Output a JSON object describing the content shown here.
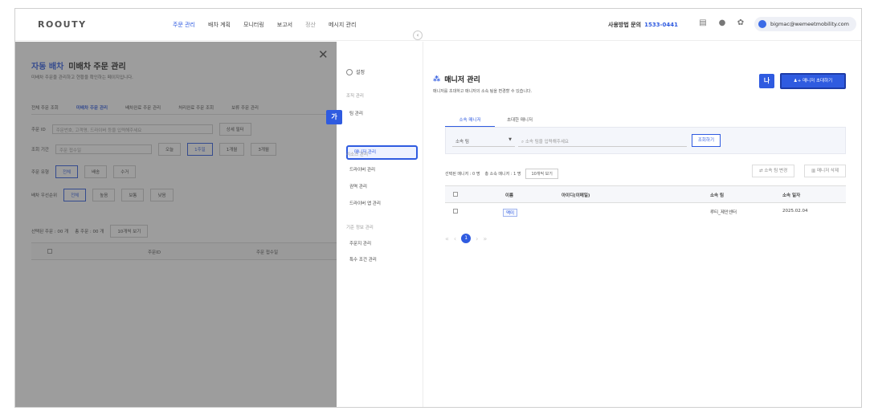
{
  "topbar": {
    "logo": "ROOUTY",
    "nav": [
      "주문 관리",
      "배차 계획",
      "모니터링",
      "보고서",
      "정산",
      "메시지 관리"
    ],
    "contact_label": "사용방법 문의",
    "contact_number": "1533-0441",
    "user_email": "bigmac@wemeetmobility.com"
  },
  "left_page": {
    "crumb": "자동 배차",
    "title": "미배차 주문 관리",
    "desc": "미배차 주문을 관리하고 현황을 확인하는 페이지입니다.",
    "tabs": [
      "전체 주문 조회",
      "미배차 주문 관리",
      "배차완료 주문 관리",
      "처리완료 주문 조회",
      "보류 주문 관리"
    ],
    "order_id_label": "주문 ID",
    "search_placeholder": "주문번호, 고객명, 드라이버 등을 입력해주세요",
    "detail_filter": "상세 필터",
    "period_label": "조회 기간",
    "date_basis": "주문 접수일",
    "period_options": [
      "오늘",
      "1주일",
      "1개월",
      "3개월"
    ],
    "order_type_label": "주문 유형",
    "order_types": [
      "전체",
      "배송",
      "수거"
    ],
    "priority_label": "배차 우선순위",
    "priorities": [
      "전체",
      "높음",
      "보통",
      "낮음"
    ],
    "selected_orders": "선택된 주문 : 00 개",
    "total_orders": "총 주문 : 00 개",
    "page_size": "10개씩 보기",
    "col_order_id": "주문ID",
    "col_received": "주문 접수일"
  },
  "settings_menu": {
    "header": "설정",
    "sections": [
      {
        "title": "조직 관리",
        "items": [
          "팀 관리",
          "매니저 관리"
        ]
      },
      {
        "title": "리소스 관리",
        "items": [
          "드라이버 관리",
          "권역 관리",
          "드라이버 앱 관리"
        ]
      },
      {
        "title": "기준 정보 관리",
        "items": [
          "주문지 관리",
          "특수 조건 관리"
        ]
      }
    ],
    "marker_ga": "가"
  },
  "manager_panel": {
    "title": "매니저 관리",
    "desc": "매니저를 초대하고 매니저의 소속 팀을 변경할 수 있습니다.",
    "invite_button": "매니저 초대하기",
    "marker_na": "나",
    "tabs": [
      "소속 매니저",
      "초대한 매니저"
    ],
    "team_select": "소속 팀",
    "name_placeholder": "소속 팀을 입력해주세요",
    "search_button": "조회하기",
    "selected_managers": "선택된 매니저 : 0 명",
    "total_managers": "총 소속 매니저 : 1 명",
    "page_size": "10개씩 보기",
    "change_team_button": "소속 팀 변경",
    "delete_button": "매니저 삭제",
    "columns": [
      "이름",
      "아이디(이메일)",
      "소속 팀",
      "소속 일자"
    ],
    "rows": [
      {
        "name": "맥미",
        "email": "",
        "team": "루티_제안센터",
        "date": "2025.02.04"
      }
    ],
    "current_page": "1"
  }
}
